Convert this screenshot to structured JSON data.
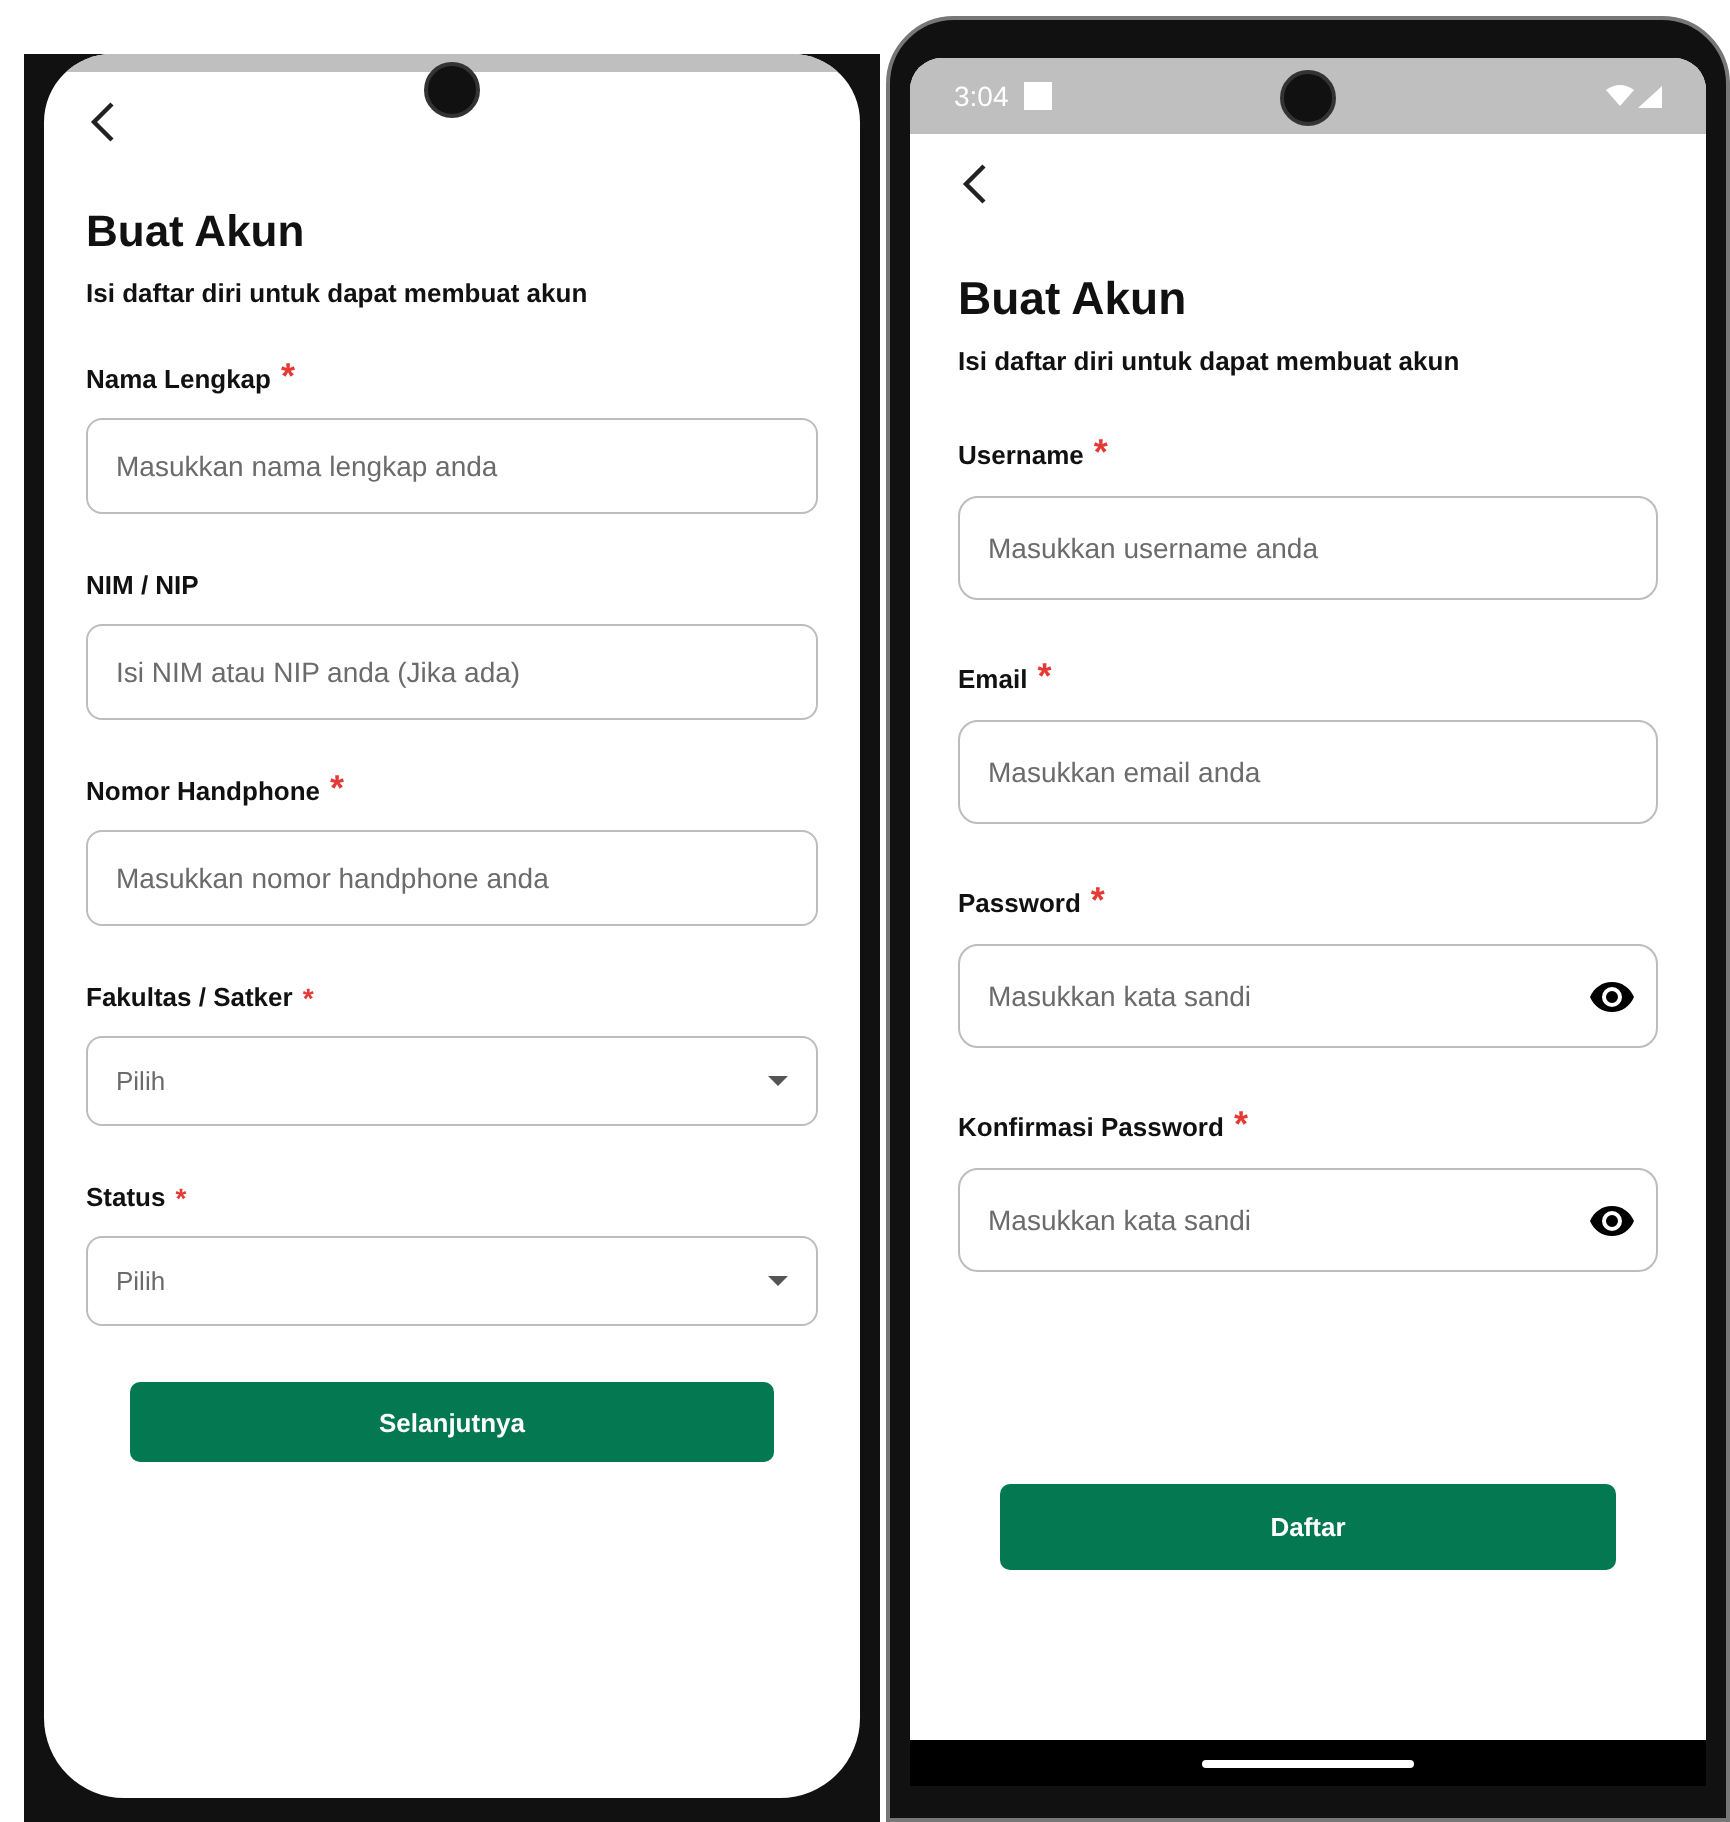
{
  "screens": [
    {
      "title": "Buat Akun",
      "subtitle": "Isi daftar diri untuk dapat membuat akun",
      "fields": [
        {
          "kind": "text",
          "label": "Nama Lengkap",
          "required_mark": "*",
          "placeholder": "Masukkan nama lengkap anda"
        },
        {
          "kind": "text",
          "label": "NIM / NIP",
          "placeholder": "Isi NIM atau NIP anda (Jika ada)"
        },
        {
          "kind": "text",
          "label": "Nomor Handphone",
          "required_mark": "*",
          "placeholder": "Masukkan nomor handphone anda"
        },
        {
          "kind": "dropdown",
          "label": "Fakultas / Satker",
          "required_mark": "*",
          "placeholder": "Pilih"
        },
        {
          "kind": "dropdown",
          "label": "Status",
          "required_mark": "*",
          "placeholder": "Pilih"
        }
      ],
      "button": "Selanjutnya"
    },
    {
      "status_bar": {
        "time": "3:04"
      },
      "title": "Buat Akun",
      "subtitle": "Isi daftar diri untuk dapat membuat akun",
      "fields": [
        {
          "kind": "text",
          "label": "Username",
          "required_mark": "*",
          "placeholder": "Masukkan username anda"
        },
        {
          "kind": "text",
          "label": "Email",
          "required_mark": "*",
          "placeholder": "Masukkan email anda"
        },
        {
          "kind": "password",
          "label": "Password",
          "required_mark": "*",
          "placeholder": "Masukkan kata sandi"
        },
        {
          "kind": "password",
          "label": "Konfirmasi Password",
          "required_mark": "*",
          "placeholder": "Masukkan kata sandi"
        }
      ],
      "button": "Daftar"
    }
  ]
}
